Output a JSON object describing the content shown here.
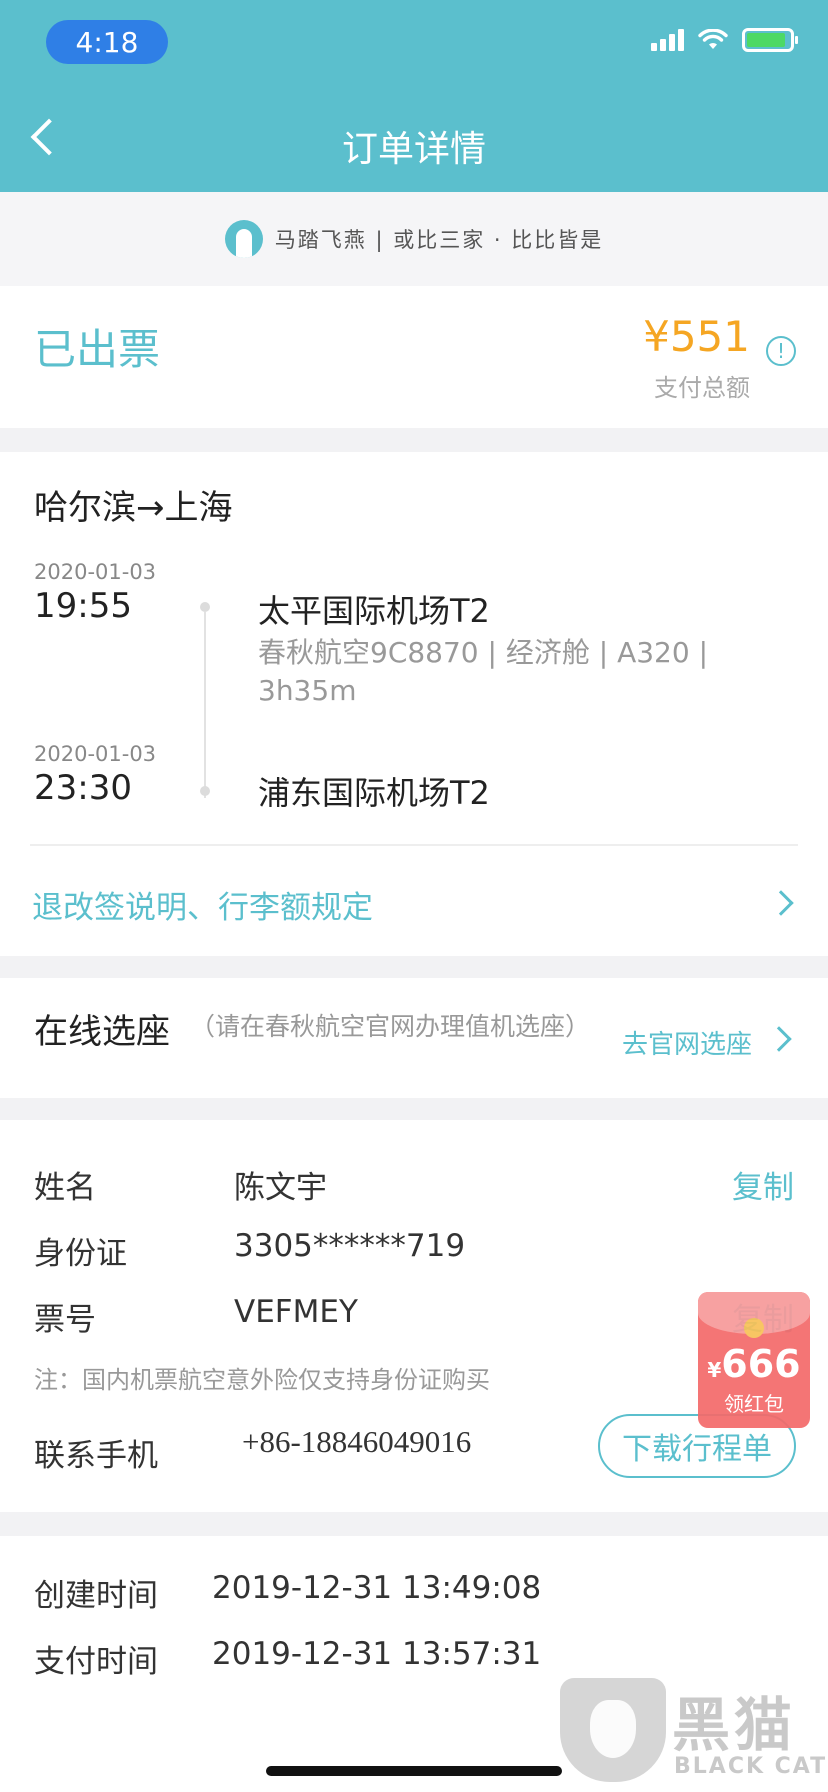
{
  "status_bar": {
    "time": "4:18"
  },
  "nav": {
    "title": "订单详情"
  },
  "brand": {
    "slogan": "马踏飞燕 | 或比三家 · 比比皆是"
  },
  "order_status": {
    "status": "已出票",
    "amount": "¥551",
    "amount_label": "支付总额"
  },
  "flight": {
    "route": "哈尔滨→上海",
    "departure": {
      "date": "2020-01-03",
      "time": "19:55",
      "airport": "太平国际机场T2"
    },
    "info": "春秋航空9C8870 | 经济舱 | A320 | 3h35m",
    "arrival": {
      "date": "2020-01-03",
      "time": "23:30",
      "airport": "浦东国际机场T2"
    },
    "rules_link": "退改签说明、行李额规定"
  },
  "seat": {
    "title": "在线选座",
    "note": "（请在春秋航空官网办理值机选座）",
    "link": "去官网选座"
  },
  "passenger": {
    "name_label": "姓名",
    "name": "陈文宇",
    "copy_label": "复制",
    "id_label": "身份证",
    "id_value": "3305******719",
    "ticket_label": "票号",
    "ticket_value": "VEFMEY",
    "copy_label_2": "复制",
    "note": "注：国内机票航空意外险仅支持身份证购买",
    "phone_label": "联系手机",
    "phone": "+86-18846049016",
    "download": "下载行程单"
  },
  "red_packet": {
    "currency": "¥",
    "amount": "666",
    "label": "领红包"
  },
  "order_info": {
    "created_label": "创建时间",
    "created_value": "2019-12-31 13:49:08",
    "paid_label": "支付时间",
    "paid_value": "2019-12-31 13:57:31"
  },
  "watermark": {
    "cn": "黑猫",
    "en": "BLACK CAT"
  },
  "colors": {
    "primary": "#5bbfcd",
    "price": "#f5a623",
    "red_packet": "#f46a6a"
  },
  "icons": [
    "back-icon",
    "signal-icon",
    "wifi-icon",
    "battery-icon",
    "info-icon",
    "chevron-right-icon"
  ]
}
